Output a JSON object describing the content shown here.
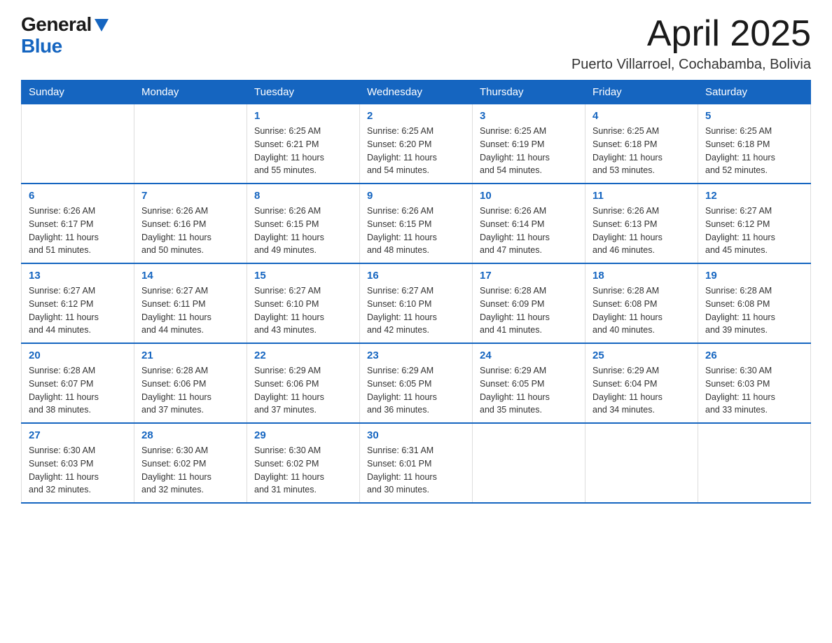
{
  "header": {
    "logo_general": "General",
    "logo_blue": "Blue",
    "title": "April 2025",
    "subtitle": "Puerto Villarroel, Cochabamba, Bolivia"
  },
  "calendar": {
    "days_of_week": [
      "Sunday",
      "Monday",
      "Tuesday",
      "Wednesday",
      "Thursday",
      "Friday",
      "Saturday"
    ],
    "weeks": [
      [
        {
          "day": "",
          "info": ""
        },
        {
          "day": "",
          "info": ""
        },
        {
          "day": "1",
          "info": "Sunrise: 6:25 AM\nSunset: 6:21 PM\nDaylight: 11 hours\nand 55 minutes."
        },
        {
          "day": "2",
          "info": "Sunrise: 6:25 AM\nSunset: 6:20 PM\nDaylight: 11 hours\nand 54 minutes."
        },
        {
          "day": "3",
          "info": "Sunrise: 6:25 AM\nSunset: 6:19 PM\nDaylight: 11 hours\nand 54 minutes."
        },
        {
          "day": "4",
          "info": "Sunrise: 6:25 AM\nSunset: 6:18 PM\nDaylight: 11 hours\nand 53 minutes."
        },
        {
          "day": "5",
          "info": "Sunrise: 6:25 AM\nSunset: 6:18 PM\nDaylight: 11 hours\nand 52 minutes."
        }
      ],
      [
        {
          "day": "6",
          "info": "Sunrise: 6:26 AM\nSunset: 6:17 PM\nDaylight: 11 hours\nand 51 minutes."
        },
        {
          "day": "7",
          "info": "Sunrise: 6:26 AM\nSunset: 6:16 PM\nDaylight: 11 hours\nand 50 minutes."
        },
        {
          "day": "8",
          "info": "Sunrise: 6:26 AM\nSunset: 6:15 PM\nDaylight: 11 hours\nand 49 minutes."
        },
        {
          "day": "9",
          "info": "Sunrise: 6:26 AM\nSunset: 6:15 PM\nDaylight: 11 hours\nand 48 minutes."
        },
        {
          "day": "10",
          "info": "Sunrise: 6:26 AM\nSunset: 6:14 PM\nDaylight: 11 hours\nand 47 minutes."
        },
        {
          "day": "11",
          "info": "Sunrise: 6:26 AM\nSunset: 6:13 PM\nDaylight: 11 hours\nand 46 minutes."
        },
        {
          "day": "12",
          "info": "Sunrise: 6:27 AM\nSunset: 6:12 PM\nDaylight: 11 hours\nand 45 minutes."
        }
      ],
      [
        {
          "day": "13",
          "info": "Sunrise: 6:27 AM\nSunset: 6:12 PM\nDaylight: 11 hours\nand 44 minutes."
        },
        {
          "day": "14",
          "info": "Sunrise: 6:27 AM\nSunset: 6:11 PM\nDaylight: 11 hours\nand 44 minutes."
        },
        {
          "day": "15",
          "info": "Sunrise: 6:27 AM\nSunset: 6:10 PM\nDaylight: 11 hours\nand 43 minutes."
        },
        {
          "day": "16",
          "info": "Sunrise: 6:27 AM\nSunset: 6:10 PM\nDaylight: 11 hours\nand 42 minutes."
        },
        {
          "day": "17",
          "info": "Sunrise: 6:28 AM\nSunset: 6:09 PM\nDaylight: 11 hours\nand 41 minutes."
        },
        {
          "day": "18",
          "info": "Sunrise: 6:28 AM\nSunset: 6:08 PM\nDaylight: 11 hours\nand 40 minutes."
        },
        {
          "day": "19",
          "info": "Sunrise: 6:28 AM\nSunset: 6:08 PM\nDaylight: 11 hours\nand 39 minutes."
        }
      ],
      [
        {
          "day": "20",
          "info": "Sunrise: 6:28 AM\nSunset: 6:07 PM\nDaylight: 11 hours\nand 38 minutes."
        },
        {
          "day": "21",
          "info": "Sunrise: 6:28 AM\nSunset: 6:06 PM\nDaylight: 11 hours\nand 37 minutes."
        },
        {
          "day": "22",
          "info": "Sunrise: 6:29 AM\nSunset: 6:06 PM\nDaylight: 11 hours\nand 37 minutes."
        },
        {
          "day": "23",
          "info": "Sunrise: 6:29 AM\nSunset: 6:05 PM\nDaylight: 11 hours\nand 36 minutes."
        },
        {
          "day": "24",
          "info": "Sunrise: 6:29 AM\nSunset: 6:05 PM\nDaylight: 11 hours\nand 35 minutes."
        },
        {
          "day": "25",
          "info": "Sunrise: 6:29 AM\nSunset: 6:04 PM\nDaylight: 11 hours\nand 34 minutes."
        },
        {
          "day": "26",
          "info": "Sunrise: 6:30 AM\nSunset: 6:03 PM\nDaylight: 11 hours\nand 33 minutes."
        }
      ],
      [
        {
          "day": "27",
          "info": "Sunrise: 6:30 AM\nSunset: 6:03 PM\nDaylight: 11 hours\nand 32 minutes."
        },
        {
          "day": "28",
          "info": "Sunrise: 6:30 AM\nSunset: 6:02 PM\nDaylight: 11 hours\nand 32 minutes."
        },
        {
          "day": "29",
          "info": "Sunrise: 6:30 AM\nSunset: 6:02 PM\nDaylight: 11 hours\nand 31 minutes."
        },
        {
          "day": "30",
          "info": "Sunrise: 6:31 AM\nSunset: 6:01 PM\nDaylight: 11 hours\nand 30 minutes."
        },
        {
          "day": "",
          "info": ""
        },
        {
          "day": "",
          "info": ""
        },
        {
          "day": "",
          "info": ""
        }
      ]
    ]
  }
}
